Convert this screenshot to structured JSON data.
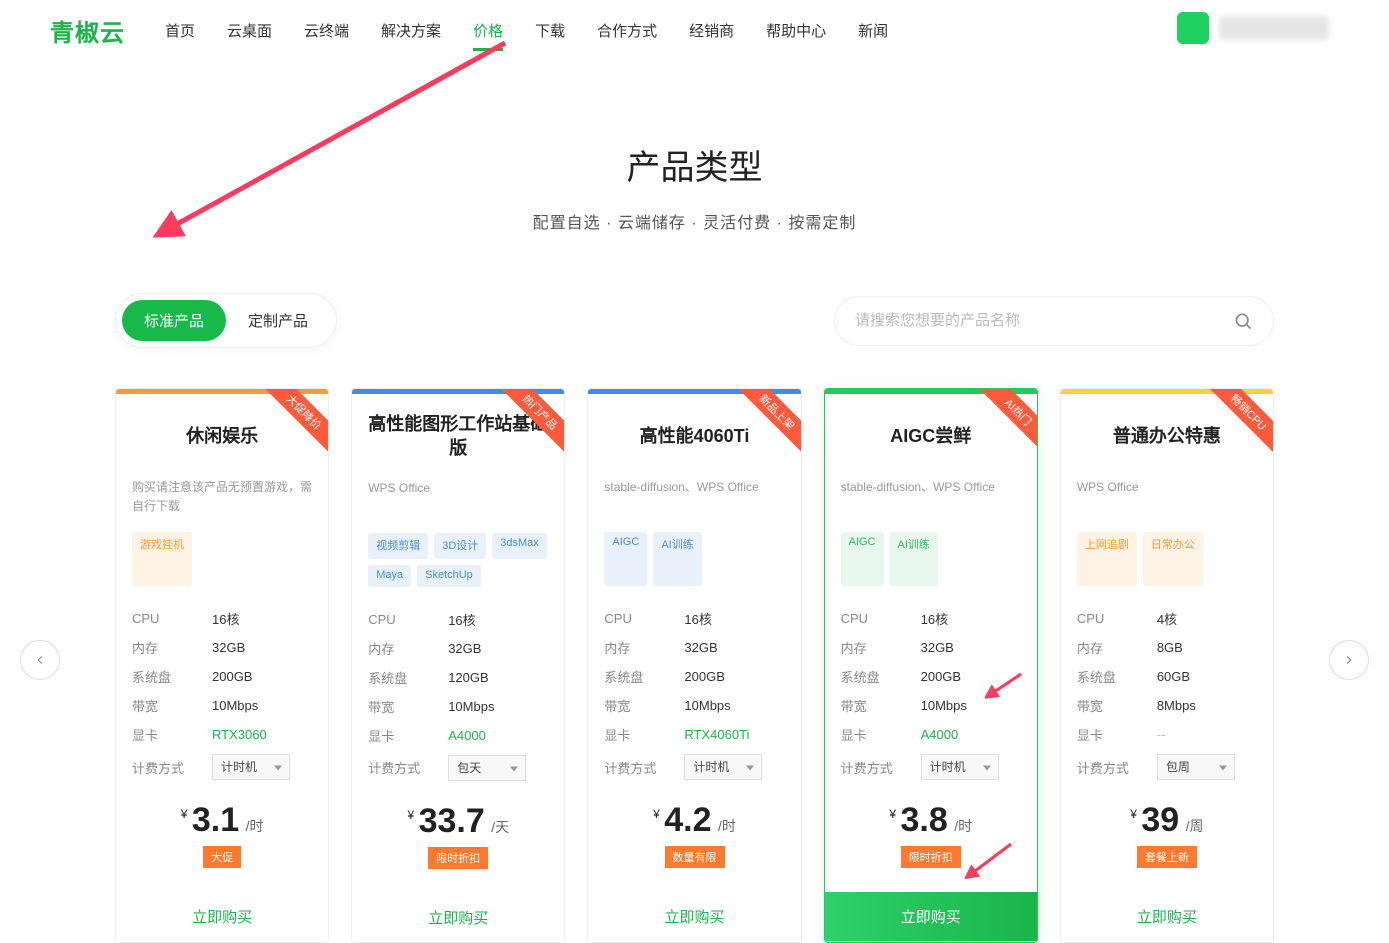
{
  "logo": "青椒云",
  "nav": [
    "首页",
    "云桌面",
    "云终端",
    "解决方案",
    "价格",
    "下载",
    "合作方式",
    "经销商",
    "帮助中心",
    "新闻"
  ],
  "nav_active_index": 4,
  "page_title": "产品类型",
  "page_subtitle": "配置自选 · 云端储存 · 灵活付费 · 按需定制",
  "tabs": {
    "standard": "标准产品",
    "custom": "定制产品"
  },
  "search_placeholder": "请搜索您想要的产品名称",
  "spec_labels": {
    "cpu": "CPU",
    "mem": "内存",
    "disk": "系统盘",
    "bw": "带宽",
    "gpu": "显卡",
    "billing": "计费方式"
  },
  "buy_label": "立即购买",
  "cards": [
    {
      "top_color": "#ff9a3c",
      "ribbon": "大促降价",
      "ribbon_bg": "#ff5a3c",
      "title": "休闲娱乐",
      "desc": "购买请注意该产品无预置游戏，需自行下载",
      "tags": [
        {
          "text": "游戏挂机",
          "cls": "orange"
        }
      ],
      "cpu": "16核",
      "mem": "32GB",
      "disk": "200GB",
      "bw": "10Mbps",
      "gpu": "RTX3060",
      "gpu_cls": "gpu-green",
      "billing": "计时机",
      "price": "3.1",
      "unit": "/时",
      "promo": "大促",
      "featured": false
    },
    {
      "top_color": "#3a8ef0",
      "ribbon": "热门产品",
      "ribbon_bg": "#ff5a3c",
      "title": "高性能图形工作站基础版",
      "desc": "WPS Office",
      "tags": [
        {
          "text": "视频剪辑",
          "cls": "blue"
        },
        {
          "text": "3D设计",
          "cls": "blue"
        },
        {
          "text": "3dsMax",
          "cls": "blue"
        },
        {
          "text": "Maya",
          "cls": "blue"
        },
        {
          "text": "SketchUp",
          "cls": "blue"
        }
      ],
      "cpu": "16核",
      "mem": "32GB",
      "disk": "120GB",
      "bw": "10Mbps",
      "gpu": "A4000",
      "gpu_cls": "gpu-green",
      "billing": "包天",
      "price": "33.7",
      "unit": "/天",
      "promo": "限时折扣",
      "featured": false
    },
    {
      "top_color": "#3a8ef0",
      "ribbon": "新品上架",
      "ribbon_bg": "#ff5a3c",
      "title": "高性能4060Ti",
      "desc": "stable-diffusion、WPS Office",
      "tags": [
        {
          "text": "AIGC",
          "cls": "blue"
        },
        {
          "text": "AI训练",
          "cls": "blue"
        }
      ],
      "cpu": "16核",
      "mem": "32GB",
      "disk": "200GB",
      "bw": "10Mbps",
      "gpu": "RTX4060Ti",
      "gpu_cls": "gpu-green",
      "billing": "计时机",
      "price": "4.2",
      "unit": "/时",
      "promo": "数量有限",
      "featured": false
    },
    {
      "top_color": "#1dcc5a",
      "ribbon": "AI热门",
      "ribbon_bg": "#ff5a3c",
      "title": "AIGC尝鲜",
      "desc": "stable-diffusion、WPS Office",
      "tags": [
        {
          "text": "AIGC",
          "cls": "green"
        },
        {
          "text": "AI训练",
          "cls": "green"
        }
      ],
      "cpu": "16核",
      "mem": "32GB",
      "disk": "200GB",
      "bw": "10Mbps",
      "gpu": "A4000",
      "gpu_cls": "gpu-green",
      "billing": "计时机",
      "price": "3.8",
      "unit": "/时",
      "promo": "限时折扣",
      "featured": true
    },
    {
      "top_color": "#ffcf3f",
      "ribbon": "畅销CPU",
      "ribbon_bg": "#ff5a3c",
      "title": "普通办公特惠",
      "desc": "WPS Office",
      "tags": [
        {
          "text": "上网追剧",
          "cls": "orange"
        },
        {
          "text": "日常办公",
          "cls": "orange"
        }
      ],
      "cpu": "4核",
      "mem": "8GB",
      "disk": "60GB",
      "bw": "8Mbps",
      "gpu": "--",
      "gpu_cls": "gpu-gray",
      "billing": "包周",
      "price": "39",
      "unit": "/周",
      "promo": "套餐上新",
      "featured": false
    }
  ]
}
